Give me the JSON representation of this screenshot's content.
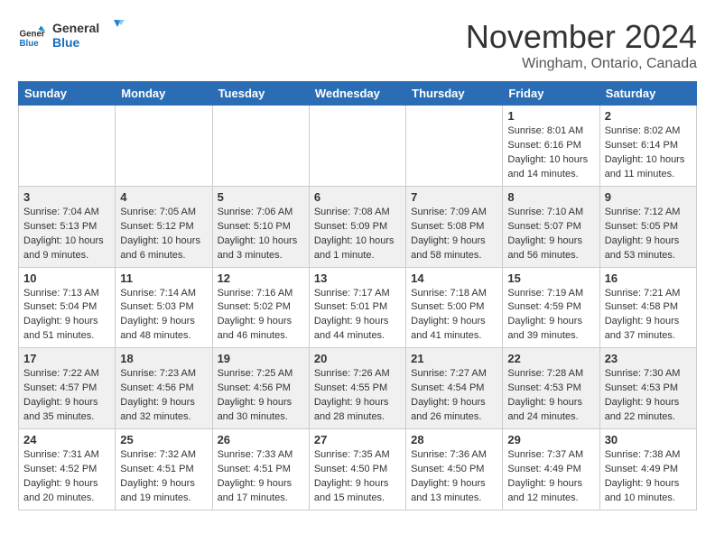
{
  "header": {
    "logo_general": "General",
    "logo_blue": "Blue",
    "month_title": "November 2024",
    "location": "Wingham, Ontario, Canada"
  },
  "weekdays": [
    "Sunday",
    "Monday",
    "Tuesday",
    "Wednesday",
    "Thursday",
    "Friday",
    "Saturday"
  ],
  "weeks": [
    [
      {
        "day": "",
        "info": ""
      },
      {
        "day": "",
        "info": ""
      },
      {
        "day": "",
        "info": ""
      },
      {
        "day": "",
        "info": ""
      },
      {
        "day": "",
        "info": ""
      },
      {
        "day": "1",
        "info": "Sunrise: 8:01 AM\nSunset: 6:16 PM\nDaylight: 10 hours and 14 minutes."
      },
      {
        "day": "2",
        "info": "Sunrise: 8:02 AM\nSunset: 6:14 PM\nDaylight: 10 hours and 11 minutes."
      }
    ],
    [
      {
        "day": "3",
        "info": "Sunrise: 7:04 AM\nSunset: 5:13 PM\nDaylight: 10 hours and 9 minutes."
      },
      {
        "day": "4",
        "info": "Sunrise: 7:05 AM\nSunset: 5:12 PM\nDaylight: 10 hours and 6 minutes."
      },
      {
        "day": "5",
        "info": "Sunrise: 7:06 AM\nSunset: 5:10 PM\nDaylight: 10 hours and 3 minutes."
      },
      {
        "day": "6",
        "info": "Sunrise: 7:08 AM\nSunset: 5:09 PM\nDaylight: 10 hours and 1 minute."
      },
      {
        "day": "7",
        "info": "Sunrise: 7:09 AM\nSunset: 5:08 PM\nDaylight: 9 hours and 58 minutes."
      },
      {
        "day": "8",
        "info": "Sunrise: 7:10 AM\nSunset: 5:07 PM\nDaylight: 9 hours and 56 minutes."
      },
      {
        "day": "9",
        "info": "Sunrise: 7:12 AM\nSunset: 5:05 PM\nDaylight: 9 hours and 53 minutes."
      }
    ],
    [
      {
        "day": "10",
        "info": "Sunrise: 7:13 AM\nSunset: 5:04 PM\nDaylight: 9 hours and 51 minutes."
      },
      {
        "day": "11",
        "info": "Sunrise: 7:14 AM\nSunset: 5:03 PM\nDaylight: 9 hours and 48 minutes."
      },
      {
        "day": "12",
        "info": "Sunrise: 7:16 AM\nSunset: 5:02 PM\nDaylight: 9 hours and 46 minutes."
      },
      {
        "day": "13",
        "info": "Sunrise: 7:17 AM\nSunset: 5:01 PM\nDaylight: 9 hours and 44 minutes."
      },
      {
        "day": "14",
        "info": "Sunrise: 7:18 AM\nSunset: 5:00 PM\nDaylight: 9 hours and 41 minutes."
      },
      {
        "day": "15",
        "info": "Sunrise: 7:19 AM\nSunset: 4:59 PM\nDaylight: 9 hours and 39 minutes."
      },
      {
        "day": "16",
        "info": "Sunrise: 7:21 AM\nSunset: 4:58 PM\nDaylight: 9 hours and 37 minutes."
      }
    ],
    [
      {
        "day": "17",
        "info": "Sunrise: 7:22 AM\nSunset: 4:57 PM\nDaylight: 9 hours and 35 minutes."
      },
      {
        "day": "18",
        "info": "Sunrise: 7:23 AM\nSunset: 4:56 PM\nDaylight: 9 hours and 32 minutes."
      },
      {
        "day": "19",
        "info": "Sunrise: 7:25 AM\nSunset: 4:56 PM\nDaylight: 9 hours and 30 minutes."
      },
      {
        "day": "20",
        "info": "Sunrise: 7:26 AM\nSunset: 4:55 PM\nDaylight: 9 hours and 28 minutes."
      },
      {
        "day": "21",
        "info": "Sunrise: 7:27 AM\nSunset: 4:54 PM\nDaylight: 9 hours and 26 minutes."
      },
      {
        "day": "22",
        "info": "Sunrise: 7:28 AM\nSunset: 4:53 PM\nDaylight: 9 hours and 24 minutes."
      },
      {
        "day": "23",
        "info": "Sunrise: 7:30 AM\nSunset: 4:53 PM\nDaylight: 9 hours and 22 minutes."
      }
    ],
    [
      {
        "day": "24",
        "info": "Sunrise: 7:31 AM\nSunset: 4:52 PM\nDaylight: 9 hours and 20 minutes."
      },
      {
        "day": "25",
        "info": "Sunrise: 7:32 AM\nSunset: 4:51 PM\nDaylight: 9 hours and 19 minutes."
      },
      {
        "day": "26",
        "info": "Sunrise: 7:33 AM\nSunset: 4:51 PM\nDaylight: 9 hours and 17 minutes."
      },
      {
        "day": "27",
        "info": "Sunrise: 7:35 AM\nSunset: 4:50 PM\nDaylight: 9 hours and 15 minutes."
      },
      {
        "day": "28",
        "info": "Sunrise: 7:36 AM\nSunset: 4:50 PM\nDaylight: 9 hours and 13 minutes."
      },
      {
        "day": "29",
        "info": "Sunrise: 7:37 AM\nSunset: 4:49 PM\nDaylight: 9 hours and 12 minutes."
      },
      {
        "day": "30",
        "info": "Sunrise: 7:38 AM\nSunset: 4:49 PM\nDaylight: 9 hours and 10 minutes."
      }
    ]
  ]
}
